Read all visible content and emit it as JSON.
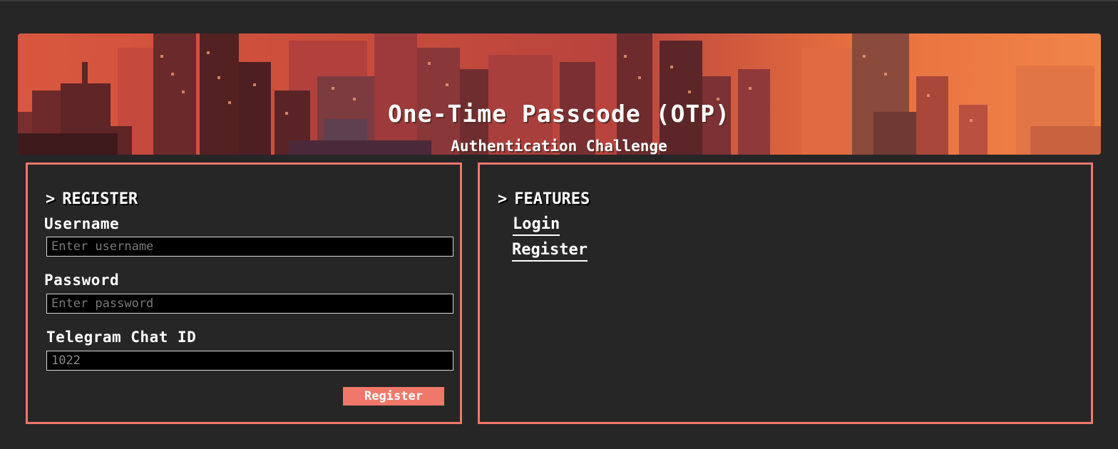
{
  "header": {
    "title": "One-Time Passcode (OTP)",
    "subtitle": "Authentication Challenge"
  },
  "register": {
    "heading_marker": ">",
    "heading": "REGISTER",
    "username_label": "Username",
    "username_placeholder": "Enter username",
    "password_label": "Password",
    "password_placeholder": "Enter password",
    "chat_id_label": "Telegram Chat ID",
    "chat_id_value": "1022",
    "submit_label": "Register"
  },
  "features": {
    "heading_marker": ">",
    "heading": "FEATURES",
    "links": [
      {
        "label": "Login"
      },
      {
        "label": "Register"
      }
    ]
  },
  "colors": {
    "background": "#262626",
    "accent": "#f0786a",
    "input_bg": "#000000",
    "text": "#ffffff"
  }
}
